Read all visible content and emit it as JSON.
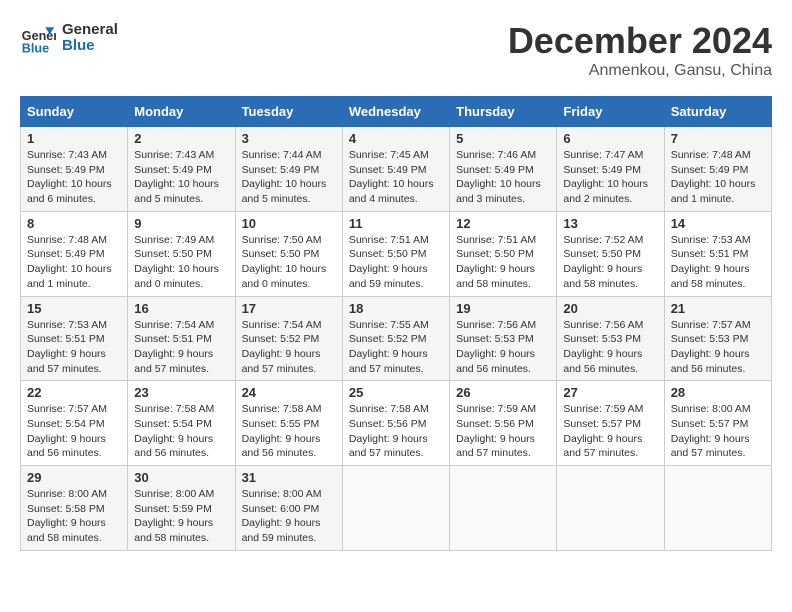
{
  "header": {
    "logo_line1": "General",
    "logo_line2": "Blue",
    "month": "December 2024",
    "location": "Anmenkou, Gansu, China"
  },
  "weekdays": [
    "Sunday",
    "Monday",
    "Tuesday",
    "Wednesday",
    "Thursday",
    "Friday",
    "Saturday"
  ],
  "weeks": [
    [
      {
        "day": "1",
        "sunrise": "7:43 AM",
        "sunset": "5:49 PM",
        "daylight": "10 hours and 6 minutes."
      },
      {
        "day": "2",
        "sunrise": "7:43 AM",
        "sunset": "5:49 PM",
        "daylight": "10 hours and 5 minutes."
      },
      {
        "day": "3",
        "sunrise": "7:44 AM",
        "sunset": "5:49 PM",
        "daylight": "10 hours and 5 minutes."
      },
      {
        "day": "4",
        "sunrise": "7:45 AM",
        "sunset": "5:49 PM",
        "daylight": "10 hours and 4 minutes."
      },
      {
        "day": "5",
        "sunrise": "7:46 AM",
        "sunset": "5:49 PM",
        "daylight": "10 hours and 3 minutes."
      },
      {
        "day": "6",
        "sunrise": "7:47 AM",
        "sunset": "5:49 PM",
        "daylight": "10 hours and 2 minutes."
      },
      {
        "day": "7",
        "sunrise": "7:48 AM",
        "sunset": "5:49 PM",
        "daylight": "10 hours and 1 minute."
      }
    ],
    [
      {
        "day": "8",
        "sunrise": "7:48 AM",
        "sunset": "5:49 PM",
        "daylight": "10 hours and 1 minute."
      },
      {
        "day": "9",
        "sunrise": "7:49 AM",
        "sunset": "5:50 PM",
        "daylight": "10 hours and 0 minutes."
      },
      {
        "day": "10",
        "sunrise": "7:50 AM",
        "sunset": "5:50 PM",
        "daylight": "10 hours and 0 minutes."
      },
      {
        "day": "11",
        "sunrise": "7:51 AM",
        "sunset": "5:50 PM",
        "daylight": "9 hours and 59 minutes."
      },
      {
        "day": "12",
        "sunrise": "7:51 AM",
        "sunset": "5:50 PM",
        "daylight": "9 hours and 58 minutes."
      },
      {
        "day": "13",
        "sunrise": "7:52 AM",
        "sunset": "5:50 PM",
        "daylight": "9 hours and 58 minutes."
      },
      {
        "day": "14",
        "sunrise": "7:53 AM",
        "sunset": "5:51 PM",
        "daylight": "9 hours and 58 minutes."
      }
    ],
    [
      {
        "day": "15",
        "sunrise": "7:53 AM",
        "sunset": "5:51 PM",
        "daylight": "9 hours and 57 minutes."
      },
      {
        "day": "16",
        "sunrise": "7:54 AM",
        "sunset": "5:51 PM",
        "daylight": "9 hours and 57 minutes."
      },
      {
        "day": "17",
        "sunrise": "7:54 AM",
        "sunset": "5:52 PM",
        "daylight": "9 hours and 57 minutes."
      },
      {
        "day": "18",
        "sunrise": "7:55 AM",
        "sunset": "5:52 PM",
        "daylight": "9 hours and 57 minutes."
      },
      {
        "day": "19",
        "sunrise": "7:56 AM",
        "sunset": "5:53 PM",
        "daylight": "9 hours and 56 minutes."
      },
      {
        "day": "20",
        "sunrise": "7:56 AM",
        "sunset": "5:53 PM",
        "daylight": "9 hours and 56 minutes."
      },
      {
        "day": "21",
        "sunrise": "7:57 AM",
        "sunset": "5:53 PM",
        "daylight": "9 hours and 56 minutes."
      }
    ],
    [
      {
        "day": "22",
        "sunrise": "7:57 AM",
        "sunset": "5:54 PM",
        "daylight": "9 hours and 56 minutes."
      },
      {
        "day": "23",
        "sunrise": "7:58 AM",
        "sunset": "5:54 PM",
        "daylight": "9 hours and 56 minutes."
      },
      {
        "day": "24",
        "sunrise": "7:58 AM",
        "sunset": "5:55 PM",
        "daylight": "9 hours and 56 minutes."
      },
      {
        "day": "25",
        "sunrise": "7:58 AM",
        "sunset": "5:56 PM",
        "daylight": "9 hours and 57 minutes."
      },
      {
        "day": "26",
        "sunrise": "7:59 AM",
        "sunset": "5:56 PM",
        "daylight": "9 hours and 57 minutes."
      },
      {
        "day": "27",
        "sunrise": "7:59 AM",
        "sunset": "5:57 PM",
        "daylight": "9 hours and 57 minutes."
      },
      {
        "day": "28",
        "sunrise": "8:00 AM",
        "sunset": "5:57 PM",
        "daylight": "9 hours and 57 minutes."
      }
    ],
    [
      {
        "day": "29",
        "sunrise": "8:00 AM",
        "sunset": "5:58 PM",
        "daylight": "9 hours and 58 minutes."
      },
      {
        "day": "30",
        "sunrise": "8:00 AM",
        "sunset": "5:59 PM",
        "daylight": "9 hours and 58 minutes."
      },
      {
        "day": "31",
        "sunrise": "8:00 AM",
        "sunset": "6:00 PM",
        "daylight": "9 hours and 59 minutes."
      },
      null,
      null,
      null,
      null
    ]
  ]
}
